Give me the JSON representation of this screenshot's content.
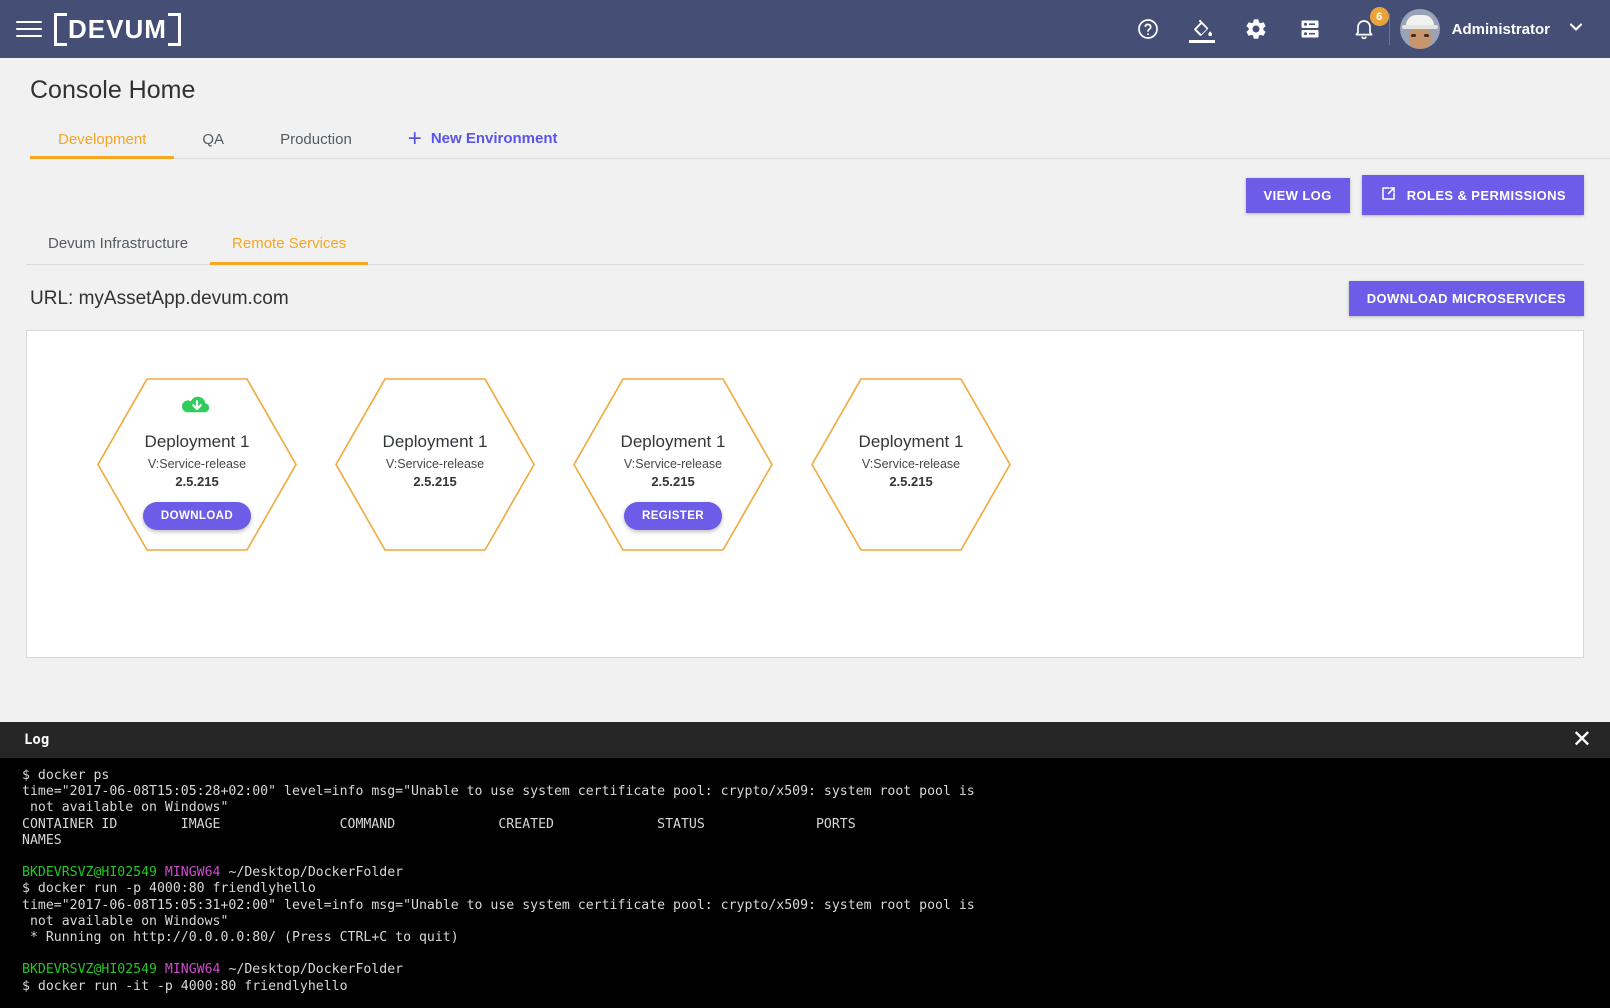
{
  "topbar": {
    "menu_icon": "hamburger-icon",
    "brand": "DEVUM",
    "icons": [
      {
        "name": "help-icon",
        "label": "Help"
      },
      {
        "name": "theme-paint-icon",
        "label": "Theme"
      },
      {
        "name": "settings-gear-icon",
        "label": "Settings"
      },
      {
        "name": "server-icon",
        "label": "Servers"
      },
      {
        "name": "notifications-bell-icon",
        "label": "Notifications"
      }
    ],
    "notification_count": "6",
    "username": "Administrator",
    "caret": "chevron-down-icon"
  },
  "page": {
    "title": "Console Home"
  },
  "environment_tabs": [
    {
      "label": "Development",
      "active": true
    },
    {
      "label": "QA",
      "active": false
    },
    {
      "label": "Production",
      "active": false
    }
  ],
  "new_environment": {
    "plus": "+",
    "label": "New Environment"
  },
  "actions": {
    "view_log": "VIEW LOG",
    "roles_permissions": "ROLES & PERMISSIONS",
    "roles_icon": "external-link-icon",
    "download_microservices": "DOWNLOAD MICROSERVICES"
  },
  "sub_tabs": [
    {
      "label": "Devum Infrastructure",
      "active": false
    },
    {
      "label": "Remote Services",
      "active": true
    }
  ],
  "url": {
    "text": "URL: myAssetApp.devum.com"
  },
  "deployments": [
    {
      "title": "Deployment 1",
      "subtitle": "V:Service-release",
      "version": "2.5.215",
      "icon": "cloud-download-icon",
      "has_icon": true,
      "button": "DOWNLOAD",
      "has_button": true
    },
    {
      "title": "Deployment 1",
      "subtitle": "V:Service-release",
      "version": "2.5.215",
      "icon": "",
      "has_icon": false,
      "button": "",
      "has_button": false
    },
    {
      "title": "Deployment 1",
      "subtitle": "V:Service-release",
      "version": "2.5.215",
      "icon": "",
      "has_icon": false,
      "button": "REGISTER",
      "has_button": true
    },
    {
      "title": "Deployment 1",
      "subtitle": "V:Service-release",
      "version": "2.5.215",
      "icon": "",
      "has_icon": false,
      "button": "",
      "has_button": false
    }
  ],
  "log": {
    "title": "Log",
    "close_icon": "close-icon",
    "lines": [
      {
        "type": "plain",
        "text": "$ docker ps"
      },
      {
        "type": "plain",
        "text": "time=\"2017-06-08T15:05:28+02:00\" level=info msg=\"Unable to use system certificate pool: crypto/x509: system root pool is"
      },
      {
        "type": "plain",
        "text": " not available on Windows\""
      },
      {
        "type": "plain",
        "text": "CONTAINER ID        IMAGE               COMMAND             CREATED             STATUS              PORTS"
      },
      {
        "type": "plain",
        "text": "NAMES"
      },
      {
        "type": "blank",
        "text": ""
      },
      {
        "type": "prompt",
        "user": "BKDEVRSVZ@HI02549",
        "shell": "MINGW64",
        "path": "~/Desktop/DockerFolder"
      },
      {
        "type": "plain",
        "text": "$ docker run -p 4000:80 friendlyhello"
      },
      {
        "type": "plain",
        "text": "time=\"2017-06-08T15:05:31+02:00\" level=info msg=\"Unable to use system certificate pool: crypto/x509: system root pool is"
      },
      {
        "type": "plain",
        "text": " not available on Windows\""
      },
      {
        "type": "plain",
        "text": " * Running on http://0.0.0.0:80/ (Press CTRL+C to quit)"
      },
      {
        "type": "blank",
        "text": ""
      },
      {
        "type": "prompt",
        "user": "BKDEVRSVZ@HI02549",
        "shell": "MINGW64",
        "path": "~/Desktop/DockerFolder"
      },
      {
        "type": "plain",
        "text": "$ docker run -it -p 4000:80 friendlyhello"
      }
    ]
  },
  "colors": {
    "header_bg": "#454f76",
    "accent_orange": "#f5a623",
    "accent_purple": "#6c5ce7",
    "badge_orange": "#e8a33d",
    "hex_border": "#f0a93c",
    "cloud_green": "#2ecc5a",
    "page_bg": "#f1f1f1",
    "log_bg": "#000000"
  }
}
